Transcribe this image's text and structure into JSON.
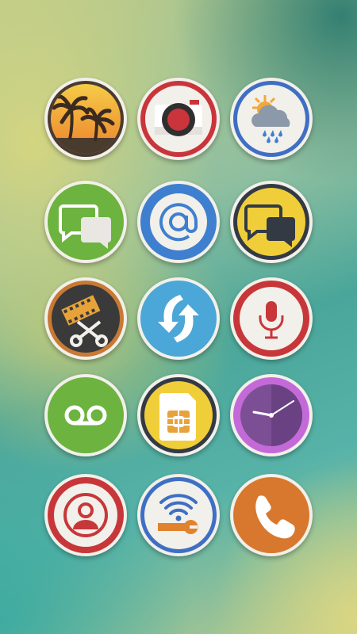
{
  "screen": {
    "type": "icon-pack-preview",
    "icons": [
      {
        "id": "gallery",
        "icon": "palm-tree-sunset-icon",
        "ring": "#4a3b2f",
        "fill": "#f0a33a"
      },
      {
        "id": "camera",
        "icon": "camera-record-icon",
        "ring": "#c9353a",
        "fill": "#f2f0ea"
      },
      {
        "id": "weather",
        "icon": "weather-sun-rain-icon",
        "ring": "#3f6fc4",
        "fill": "#f2f0ea"
      },
      {
        "id": "messaging",
        "icon": "chat-bubbles-icon",
        "ring": "#6db33f",
        "fill": "#6db33f"
      },
      {
        "id": "email",
        "icon": "at-sign-icon",
        "ring": "#3f7fcf",
        "fill": "#3f7fcf"
      },
      {
        "id": "hangouts",
        "icon": "chat-bubbles-dark-icon",
        "ring": "#333a44",
        "fill": "#f0ce3a"
      },
      {
        "id": "video-editor",
        "icon": "film-scissors-icon",
        "ring": "#c87a34",
        "fill": "#3a3a3a"
      },
      {
        "id": "sync",
        "icon": "sync-arrows-icon",
        "ring": "#4aa7d8",
        "fill": "#4aa7d8"
      },
      {
        "id": "voice-recorder",
        "icon": "microphone-icon",
        "ring": "#c7373a",
        "fill": "#f2f0ea"
      },
      {
        "id": "voicemail",
        "icon": "voicemail-icon",
        "ring": "#6db33f",
        "fill": "#6db33f"
      },
      {
        "id": "sim-toolkit",
        "icon": "sim-card-icon",
        "ring": "#333a44",
        "fill": "#f0ce3a"
      },
      {
        "id": "clock",
        "icon": "clock-icon",
        "ring": "#c36ad8",
        "fill": "#7c4f95"
      },
      {
        "id": "contacts",
        "icon": "contact-person-icon",
        "ring": "#c7373a",
        "fill": "#f2f0ea"
      },
      {
        "id": "wifi-settings",
        "icon": "wifi-wrench-icon",
        "ring": "#3f6fc4",
        "fill": "#f2f0ea"
      },
      {
        "id": "phone",
        "icon": "phone-handset-icon",
        "ring": "#d8782e",
        "fill": "#d8782e"
      }
    ]
  }
}
